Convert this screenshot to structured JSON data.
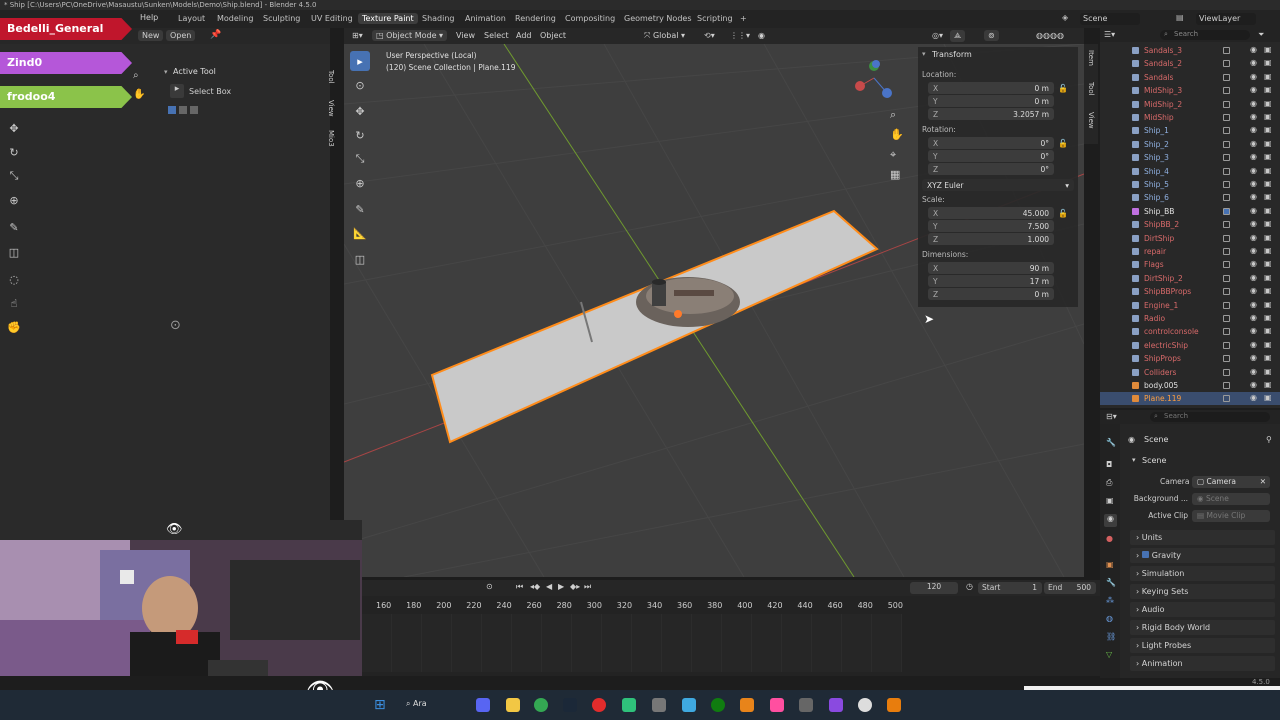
{
  "title_bar": "* Ship [C:\\Users\\PC\\OneDrive\\Masaustu\\Sunken\\Models\\Demo\\Ship.blend] - Blender 4.5.0",
  "menu": {
    "help": "Help",
    "new": "New",
    "open": "Open"
  },
  "workspaces": [
    "Layout",
    "Modeling",
    "Sculpting",
    "UV Editing",
    "Texture Paint",
    "Shading",
    "Animation",
    "Rendering",
    "Compositing",
    "Geometry Nodes",
    "Scripting",
    "+"
  ],
  "active_workspace_index": 4,
  "top_right": {
    "scene_label": "Scene",
    "viewlayer_label": "ViewLayer"
  },
  "badges": [
    {
      "text": "Bedelli_General",
      "bg": "#c0162c",
      "fg": "#ffffff"
    },
    {
      "text": "Zind0",
      "bg": "#b557d9",
      "fg": "#ffffff"
    },
    {
      "text": "frodoo4",
      "bg": "#8bc34a",
      "fg": "#ffffff"
    }
  ],
  "active_tool": {
    "header": "Active Tool",
    "tool": "Select Box"
  },
  "side_tabs_left": [
    "Tool",
    "View",
    "Mio3"
  ],
  "viewport_header": {
    "mode": "Object Mode",
    "menus": [
      "View",
      "Select",
      "Add",
      "Object"
    ],
    "orientation": "Global"
  },
  "viewport_overlay": {
    "line1": "User Perspective (Local)",
    "line2": "(120) Scene Collection | Plane.119"
  },
  "npanel": {
    "transform_header": "Transform",
    "location_label": "Location:",
    "location": [
      {
        "axis": "X",
        "value": "0 m"
      },
      {
        "axis": "Y",
        "value": "0 m"
      },
      {
        "axis": "Z",
        "value": "3.2057 m"
      }
    ],
    "rotation_label": "Rotation:",
    "rotation": [
      {
        "axis": "X",
        "value": "0°"
      },
      {
        "axis": "Y",
        "value": "0°"
      },
      {
        "axis": "Z",
        "value": "0°"
      }
    ],
    "rotation_mode": "XYZ Euler",
    "scale_label": "Scale:",
    "scale": [
      {
        "axis": "X",
        "value": "45.000"
      },
      {
        "axis": "Y",
        "value": "7.500"
      },
      {
        "axis": "Z",
        "value": "1.000"
      }
    ],
    "dimensions_label": "Dimensions:",
    "dimensions": [
      {
        "axis": "X",
        "value": "90 m"
      },
      {
        "axis": "Y",
        "value": "17 m"
      },
      {
        "axis": "Z",
        "value": "0 m"
      }
    ],
    "tabs": [
      "Item",
      "Tool",
      "View"
    ]
  },
  "outliner": {
    "search_placeholder": "Search",
    "items": [
      "Sandals_3",
      "Sandals_2",
      "Sandals",
      "MidShip_3",
      "MidShip_2",
      "MidShip",
      "Ship_1",
      "Ship_2",
      "Ship_3",
      "Ship_4",
      "Ship_5",
      "Ship_6",
      "Ship_BB",
      "ShipBB_2",
      "DirtShip",
      "repair",
      "Flags",
      "DirtShip_2",
      "ShipBBProps",
      "Engine_1",
      "Radio",
      "controlconsole",
      "electricShip",
      "ShipProps",
      "Colliders",
      "body.005",
      "Plane.119"
    ]
  },
  "properties": {
    "search_placeholder": "Search",
    "breadcrumb": "Scene",
    "scene_section": "Scene",
    "camera_label": "Camera",
    "camera_value": "Camera",
    "background_label": "Background ...",
    "background_value": "Scene",
    "active_clip_label": "Active Clip",
    "active_clip_value": "Movie Clip",
    "sections": [
      "Units",
      "Gravity",
      "Simulation",
      "Keying Sets",
      "Audio",
      "Rigid Body World",
      "Light Probes",
      "Animation"
    ]
  },
  "timeline": {
    "current_frame": "120",
    "start_label": "Start",
    "start_value": "1",
    "end_label": "End",
    "end_value": "500",
    "ticks": [
      "160",
      "180",
      "200",
      "220",
      "240",
      "260",
      "280",
      "300",
      "320",
      "340",
      "360",
      "380",
      "400",
      "420",
      "440",
      "460",
      "480",
      "500"
    ]
  },
  "taskbar": {
    "search_label": "Ara"
  },
  "version": "4.5.0",
  "colors": {
    "accent": "#4772b3",
    "selection_outline": "#ff8c1a"
  }
}
